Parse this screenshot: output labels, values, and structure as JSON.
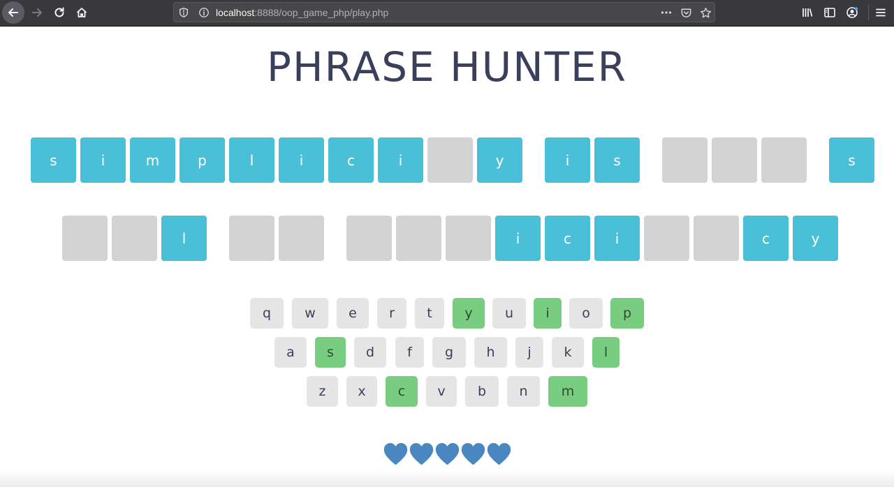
{
  "browser": {
    "url_host": "localhost",
    "url_path": ":8888/oop_game_php/play.php"
  },
  "game": {
    "title": "PHRASE HUNTER",
    "phrase_row1": [
      {
        "letter": "s",
        "shown": true
      },
      {
        "letter": "i",
        "shown": true
      },
      {
        "letter": "m",
        "shown": true
      },
      {
        "letter": "p",
        "shown": true
      },
      {
        "letter": "l",
        "shown": true
      },
      {
        "letter": "i",
        "shown": true
      },
      {
        "letter": "c",
        "shown": true
      },
      {
        "letter": "i",
        "shown": true
      },
      {
        "letter": "",
        "shown": false
      },
      {
        "letter": "y",
        "shown": true
      },
      {
        "letter": "i",
        "shown": true
      },
      {
        "letter": "s",
        "shown": true
      },
      {
        "letter": "",
        "shown": false
      },
      {
        "letter": "",
        "shown": false
      },
      {
        "letter": "",
        "shown": false
      },
      {
        "letter": "s",
        "shown": true
      }
    ],
    "phrase_row2": [
      {
        "letter": "",
        "shown": false
      },
      {
        "letter": "",
        "shown": false
      },
      {
        "letter": "l",
        "shown": true
      },
      {
        "letter": "",
        "shown": false
      },
      {
        "letter": "",
        "shown": false
      },
      {
        "letter": "",
        "shown": false
      },
      {
        "letter": "",
        "shown": false
      },
      {
        "letter": "",
        "shown": false
      },
      {
        "letter": "i",
        "shown": true
      },
      {
        "letter": "c",
        "shown": true
      },
      {
        "letter": "i",
        "shown": true
      },
      {
        "letter": "",
        "shown": false
      },
      {
        "letter": "",
        "shown": false
      },
      {
        "letter": "c",
        "shown": true
      },
      {
        "letter": "y",
        "shown": true
      }
    ],
    "keyboard": {
      "row1": [
        {
          "key": "q",
          "chosen": false
        },
        {
          "key": "w",
          "chosen": false
        },
        {
          "key": "e",
          "chosen": false
        },
        {
          "key": "r",
          "chosen": false
        },
        {
          "key": "t",
          "chosen": false
        },
        {
          "key": "y",
          "chosen": true
        },
        {
          "key": "u",
          "chosen": false
        },
        {
          "key": "i",
          "chosen": true
        },
        {
          "key": "o",
          "chosen": false
        },
        {
          "key": "p",
          "chosen": true
        }
      ],
      "row2": [
        {
          "key": "a",
          "chosen": false
        },
        {
          "key": "s",
          "chosen": true
        },
        {
          "key": "d",
          "chosen": false
        },
        {
          "key": "f",
          "chosen": false
        },
        {
          "key": "g",
          "chosen": false
        },
        {
          "key": "h",
          "chosen": false
        },
        {
          "key": "j",
          "chosen": false
        },
        {
          "key": "k",
          "chosen": false
        },
        {
          "key": "l",
          "chosen": true
        }
      ],
      "row3": [
        {
          "key": "z",
          "chosen": false
        },
        {
          "key": "x",
          "chosen": false
        },
        {
          "key": "c",
          "chosen": true
        },
        {
          "key": "v",
          "chosen": false
        },
        {
          "key": "b",
          "chosen": false
        },
        {
          "key": "n",
          "chosen": false
        },
        {
          "key": "m",
          "chosen": true
        }
      ]
    },
    "lives": 5,
    "colors": {
      "revealed_tile": "#4ac0d8",
      "hidden_tile": "#d3d3d3",
      "chosen_key": "#79cd80",
      "key": "#e5e5e5",
      "heart": "#4a86c0"
    }
  }
}
